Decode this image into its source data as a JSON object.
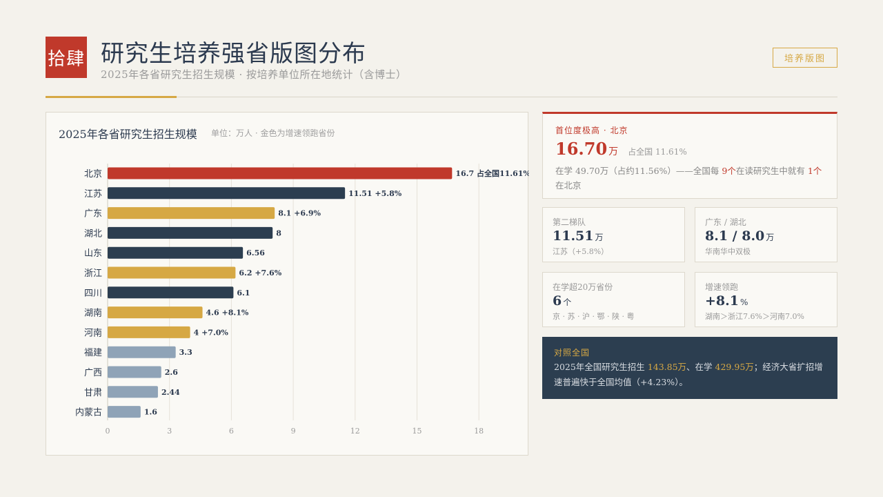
{
  "header": {
    "stamp": "拾肆",
    "title": "研究生培养强省版图分布",
    "subtitle": "2025年各省研究生招生规模 · 按培养单位所在地统计（含博士）",
    "tag_button": "培养版图"
  },
  "chart_panel": {
    "title": "2025年各省研究生招生规模",
    "subtitle": "单位：万人 · 金色为增速领跑省份"
  },
  "chart_data": {
    "type": "bar",
    "orientation": "horizontal",
    "categories": [
      "北京",
      "江苏",
      "广东",
      "湖北",
      "山东",
      "浙江",
      "四川",
      "湖南",
      "河南",
      "福建",
      "广西",
      "甘肃",
      "内蒙古"
    ],
    "values": [
      16.7,
      11.51,
      8.1,
      8,
      6.56,
      6.2,
      6.1,
      4.6,
      4,
      3.3,
      2.6,
      2.44,
      1.6
    ],
    "data_labels": [
      "16.7 占全国11.61%",
      "11.51 +5.8%",
      "8.1 +6.9%",
      "8",
      "6.56",
      "6.2 +7.6%",
      "6.1",
      "4.6 +8.1%",
      "4 +7.0%",
      "3.3",
      "2.6",
      "2.44",
      "1.6"
    ],
    "bar_colors": [
      "#c0392b",
      "#2c3e50",
      "#d6a844",
      "#2c3e50",
      "#2c3e50",
      "#d6a844",
      "#2c3e50",
      "#d6a844",
      "#d6a844",
      "#8fa3b7",
      "#8fa3b7",
      "#8fa3b7",
      "#8fa3b7"
    ],
    "xlim": [
      0,
      20
    ],
    "xticks": [
      0,
      3,
      6,
      9,
      12,
      15,
      18
    ],
    "grid": true,
    "title": "2025年各省研究生招生规模",
    "xlabel": "",
    "ylabel": ""
  },
  "cards": {
    "hero": {
      "label": "首位度极高 · 北京",
      "value": "16.70",
      "unit": "万",
      "share": "占全国 11.61%",
      "desc_prefix": "在学 49.70万（占约11.56%）——全国每 ",
      "desc_hl1": "9个",
      "desc_mid": "在读研究生中就有 ",
      "desc_hl2": "1个",
      "desc_suffix": "在北京"
    },
    "second_tier": {
      "label": "第二梯队",
      "value": "11.51",
      "unit": "万",
      "note": "江苏（+5.8%）"
    },
    "gd_hb": {
      "label": "广东 / 湖北",
      "value": "8.1 / 8.0",
      "unit": "万",
      "note": "华南华中双极"
    },
    "over20": {
      "label": "在学超20万省份",
      "value": "6",
      "unit": "个",
      "note": "京 · 苏 · 沪 · 鄂 · 陕 · 粤"
    },
    "growth": {
      "label": "增速领跑",
      "value": "+8.1",
      "unit": "%",
      "note": "湖南＞浙江7.6%＞河南7.0%"
    },
    "national": {
      "label": "对照全国",
      "desc_prefix": "2025年全国研究生招生 ",
      "enroll": "143.85万",
      "desc_mid": "、在学 ",
      "total": "429.95万",
      "desc_suffix": "；经济大省扩招增速普遍快于全国均值（+4.23%）。"
    }
  },
  "colors": {
    "accent_red": "#c0392b",
    "navy": "#2c3e50",
    "gold": "#d6a844",
    "slate": "#8fa3b7"
  }
}
